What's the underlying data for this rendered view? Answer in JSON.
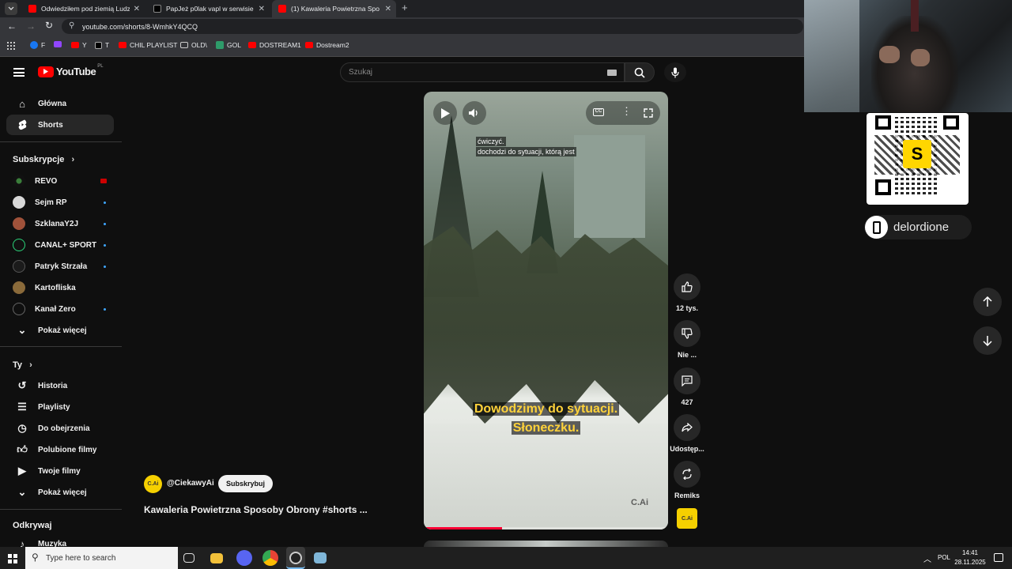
{
  "browser": {
    "tabs": [
      {
        "title": "Odwiedziłem pod ziemią Ludzi",
        "color": "#ff0000"
      },
      {
        "title": "PapJeż p0lak vapl w serwisie X",
        "color": "#000000"
      },
      {
        "title": "(1) Kawaleria Powietrzna Sposo",
        "color": "#ff0000"
      }
    ],
    "url": "youtube.com/shorts/8-WmhkY4QCQ",
    "bookmarks": [
      "F",
      "",
      "Y",
      "T",
      "CHIL PLAYLIST",
      "OLD\\",
      "GOL",
      "DOSTREAM1",
      "Dostream2"
    ]
  },
  "yt": {
    "logo_text": "YouTube",
    "region": "PL",
    "search_placeholder": "Szukaj",
    "sidebar": {
      "main": [
        "Główna",
        "Shorts"
      ],
      "subs_heading": "Subskrypcje",
      "channels": [
        "REVO",
        "Sejm RP",
        "SzklanaY2J",
        "CANAL+ SPORT",
        "Patryk Strzała",
        "Kartofliska",
        "Kanał Zero"
      ],
      "show_more": "Pokaż więcej",
      "you_heading": "Ty",
      "you_items": [
        "Historia",
        "Playlisty",
        "Do obejrzenia",
        "Polubione filmy",
        "Twoje filmy",
        "Pokaż więcej"
      ],
      "explore_heading": "Odkrywaj",
      "explore_items": [
        "Muzyka"
      ]
    },
    "short": {
      "caption_line1": "ćwiczyć.",
      "caption_line2": "dochodzi do sytuacji, którą jest",
      "subtitle_line1": "Dowodzimy do sytuacji.",
      "subtitle_line2": "Słoneczku.",
      "watermark": "C.Ai",
      "channel": "@CiekawyAi",
      "subscribe": "Subskrybuj",
      "title": "Kawaleria Powietrzna Sposoby Obrony #shorts ...",
      "progress": 0.32
    },
    "actions": {
      "likes": "12 tys.",
      "dislike": "Nie ...",
      "comments": "427",
      "share": "Udostęp...",
      "remix": "Remiks",
      "channel_badge": "C.Ai"
    }
  },
  "overlay": {
    "handle": "delordione"
  },
  "taskbar": {
    "search_placeholder": "Type here to search",
    "lang": "POL",
    "time": "14:41",
    "date": "28.11.2025"
  }
}
